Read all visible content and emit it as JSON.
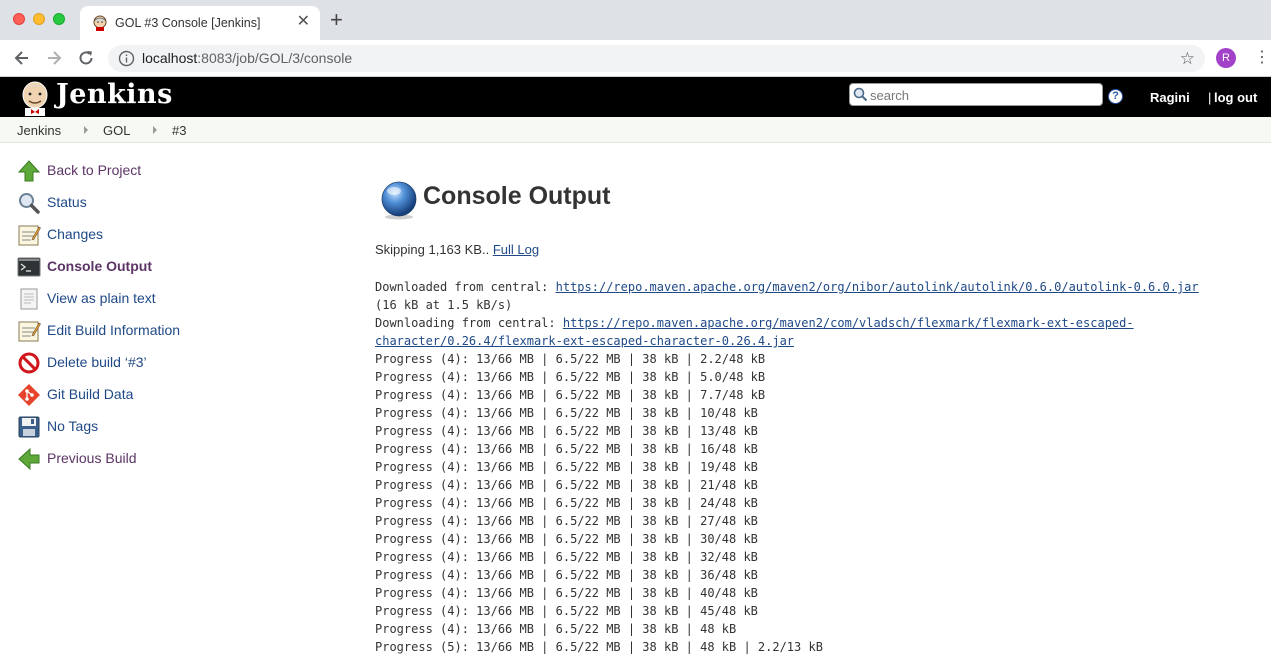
{
  "browser": {
    "tab_title": "GOL #3 Console [Jenkins]",
    "close_glyph": "✕",
    "newtab_glyph": "+",
    "url_host": "localhost",
    "url_path": ":8083/job/GOL/3/console",
    "profile_initial": "R",
    "star_glyph": "☆",
    "menu_glyph": "⋮"
  },
  "header": {
    "title": "Jenkins",
    "search_placeholder": "search",
    "help_glyph": "?",
    "user": "Ragini",
    "separator": "|",
    "logout": "log out"
  },
  "breadcrumb": [
    "Jenkins",
    "GOL",
    "#3"
  ],
  "sidebar": {
    "items": [
      {
        "label": "Back to Project",
        "icon": "up-arrow-icon"
      },
      {
        "label": "Status",
        "icon": "magnifier-icon"
      },
      {
        "label": "Changes",
        "icon": "notepad-icon"
      },
      {
        "label": "Console Output",
        "icon": "terminal-icon"
      },
      {
        "label": "View as plain text",
        "icon": "document-icon"
      },
      {
        "label": "Edit Build Information",
        "icon": "notepad-icon"
      },
      {
        "label": "Delete build ‘#3’",
        "icon": "no-entry-icon"
      },
      {
        "label": "Git Build Data",
        "icon": "git-icon"
      },
      {
        "label": "No Tags",
        "icon": "floppy-icon"
      },
      {
        "label": "Previous Build",
        "icon": "left-arrow-icon"
      }
    ]
  },
  "main": {
    "title": "Console Output",
    "skip_text": "Skipping 1,163 KB.. ",
    "full_log": "Full Log",
    "console": {
      "dl1_prefix": "Downloaded from central: ",
      "dl1_link": "https://repo.maven.apache.org/maven2/org/nibor/autolink/autolink/0.6.0/autolink-0.6.0.jar",
      "dl1_rate": "(16 kB at 1.5 kB/s)",
      "dl2_prefix": "Downloading from central: ",
      "dl2_link_a": "https://repo.maven.apache.org/maven2/com/vladsch/flexmark/flexmark-ext-escaped-",
      "dl2_link_b": "character/0.26.4/flexmark-ext-escaped-character-0.26.4.jar",
      "progress": [
        "Progress (4): 13/66 MB | 6.5/22 MB | 38 kB | 2.2/48 kB",
        "Progress (4): 13/66 MB | 6.5/22 MB | 38 kB | 5.0/48 kB",
        "Progress (4): 13/66 MB | 6.5/22 MB | 38 kB | 7.7/48 kB",
        "Progress (4): 13/66 MB | 6.5/22 MB | 38 kB | 10/48 kB",
        "Progress (4): 13/66 MB | 6.5/22 MB | 38 kB | 13/48 kB",
        "Progress (4): 13/66 MB | 6.5/22 MB | 38 kB | 16/48 kB",
        "Progress (4): 13/66 MB | 6.5/22 MB | 38 kB | 19/48 kB",
        "Progress (4): 13/66 MB | 6.5/22 MB | 38 kB | 21/48 kB",
        "Progress (4): 13/66 MB | 6.5/22 MB | 38 kB | 24/48 kB",
        "Progress (4): 13/66 MB | 6.5/22 MB | 38 kB | 27/48 kB",
        "Progress (4): 13/66 MB | 6.5/22 MB | 38 kB | 30/48 kB",
        "Progress (4): 13/66 MB | 6.5/22 MB | 38 kB | 32/48 kB",
        "Progress (4): 13/66 MB | 6.5/22 MB | 38 kB | 36/48 kB",
        "Progress (4): 13/66 MB | 6.5/22 MB | 38 kB | 40/48 kB",
        "Progress (4): 13/66 MB | 6.5/22 MB | 38 kB | 45/48 kB",
        "Progress (4): 13/66 MB | 6.5/22 MB | 38 kB | 48 kB",
        "Progress (5): 13/66 MB | 6.5/22 MB | 38 kB | 48 kB | 2.2/13 kB"
      ]
    }
  },
  "colors": {
    "link": "#204a87",
    "visited": "#5c3566",
    "header_bg": "#000000",
    "breadcrumb_bg": "#f6faf2"
  }
}
